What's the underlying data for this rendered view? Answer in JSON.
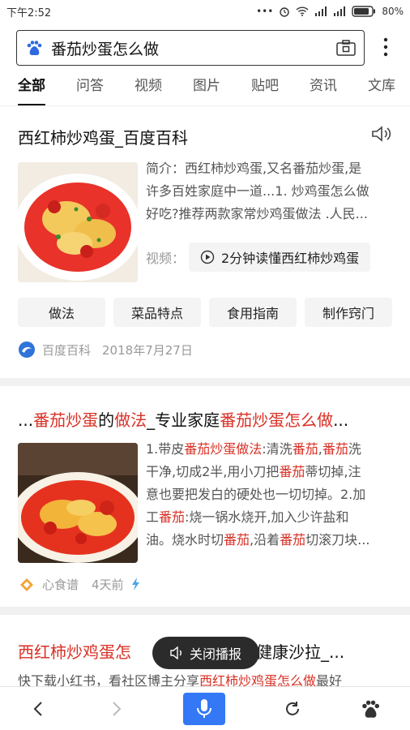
{
  "status": {
    "time": "下午2:52",
    "battery": "80%"
  },
  "search": {
    "query": "番茄炒蛋怎么做"
  },
  "tabs": [
    "全部",
    "问答",
    "视频",
    "图片",
    "贴吧",
    "资讯",
    "文库"
  ],
  "result1": {
    "title": "西红柿炒鸡蛋_百度百科",
    "snippet_lines": [
      "简介：西红柿炒鸡蛋,又名番茄炒蛋,是",
      "许多百姓家庭中一道...1. 炒鸡蛋怎么做",
      "好吃?推荐两款家常炒鸡蛋做法 .人民..."
    ],
    "video_label": "视频：",
    "video_button": "2分钟读懂西红柿炒鸡蛋",
    "pills": [
      "做法",
      "菜品特点",
      "食用指南",
      "制作窍门"
    ],
    "source": "百度百科",
    "date": "2018年7月27日"
  },
  "result2": {
    "title_parts": [
      {
        "text": "...",
        "hl": false
      },
      {
        "text": "番茄炒蛋",
        "hl": true
      },
      {
        "text": "的",
        "hl": false
      },
      {
        "text": "做法",
        "hl": true
      },
      {
        "text": "_专业家庭",
        "hl": false
      },
      {
        "text": "番茄炒蛋怎么做",
        "hl": true
      },
      {
        "text": "...",
        "hl": false
      }
    ],
    "snippet_lines": [
      [
        {
          "text": "1.带皮",
          "hl": false
        },
        {
          "text": "番茄炒蛋做法",
          "hl": true
        },
        {
          "text": ":清洗",
          "hl": false
        },
        {
          "text": "番茄",
          "hl": true
        },
        {
          "text": ",",
          "hl": false
        },
        {
          "text": "番茄",
          "hl": true
        },
        {
          "text": "洗",
          "hl": false
        }
      ],
      [
        {
          "text": "干净,切成2半,用小刀把",
          "hl": false
        },
        {
          "text": "番茄",
          "hl": true
        },
        {
          "text": "蒂切掉,注",
          "hl": false
        }
      ],
      [
        {
          "text": "意也要把发白的硬处也一切切掉。2.加",
          "hl": false
        }
      ],
      [
        {
          "text": "工",
          "hl": false
        },
        {
          "text": "番茄",
          "hl": true
        },
        {
          "text": ":烧一锅水烧开,加入少许盐和",
          "hl": false
        }
      ],
      [
        {
          "text": "油。烧水时切",
          "hl": false
        },
        {
          "text": "番茄",
          "hl": true
        },
        {
          "text": ",沿着",
          "hl": false
        },
        {
          "text": "番茄",
          "hl": true
        },
        {
          "text": "切滚刀块...",
          "hl": false
        }
      ]
    ],
    "source": "心食谱",
    "age": "4天前"
  },
  "result3": {
    "title_left": "西红柿炒鸡蛋怎",
    "title_right": "健康沙拉_...",
    "snippet_parts": [
      {
        "text": "快下载小红书，看社区博主分享",
        "hl": false
      },
      {
        "text": "西红柿炒鸡蛋怎么做",
        "hl": true
      },
      {
        "text": "最好",
        "hl": false
      }
    ]
  },
  "toast": {
    "label": "关闭播报"
  },
  "colors": {
    "highlight": "#d93025",
    "accent": "#3478f6"
  }
}
